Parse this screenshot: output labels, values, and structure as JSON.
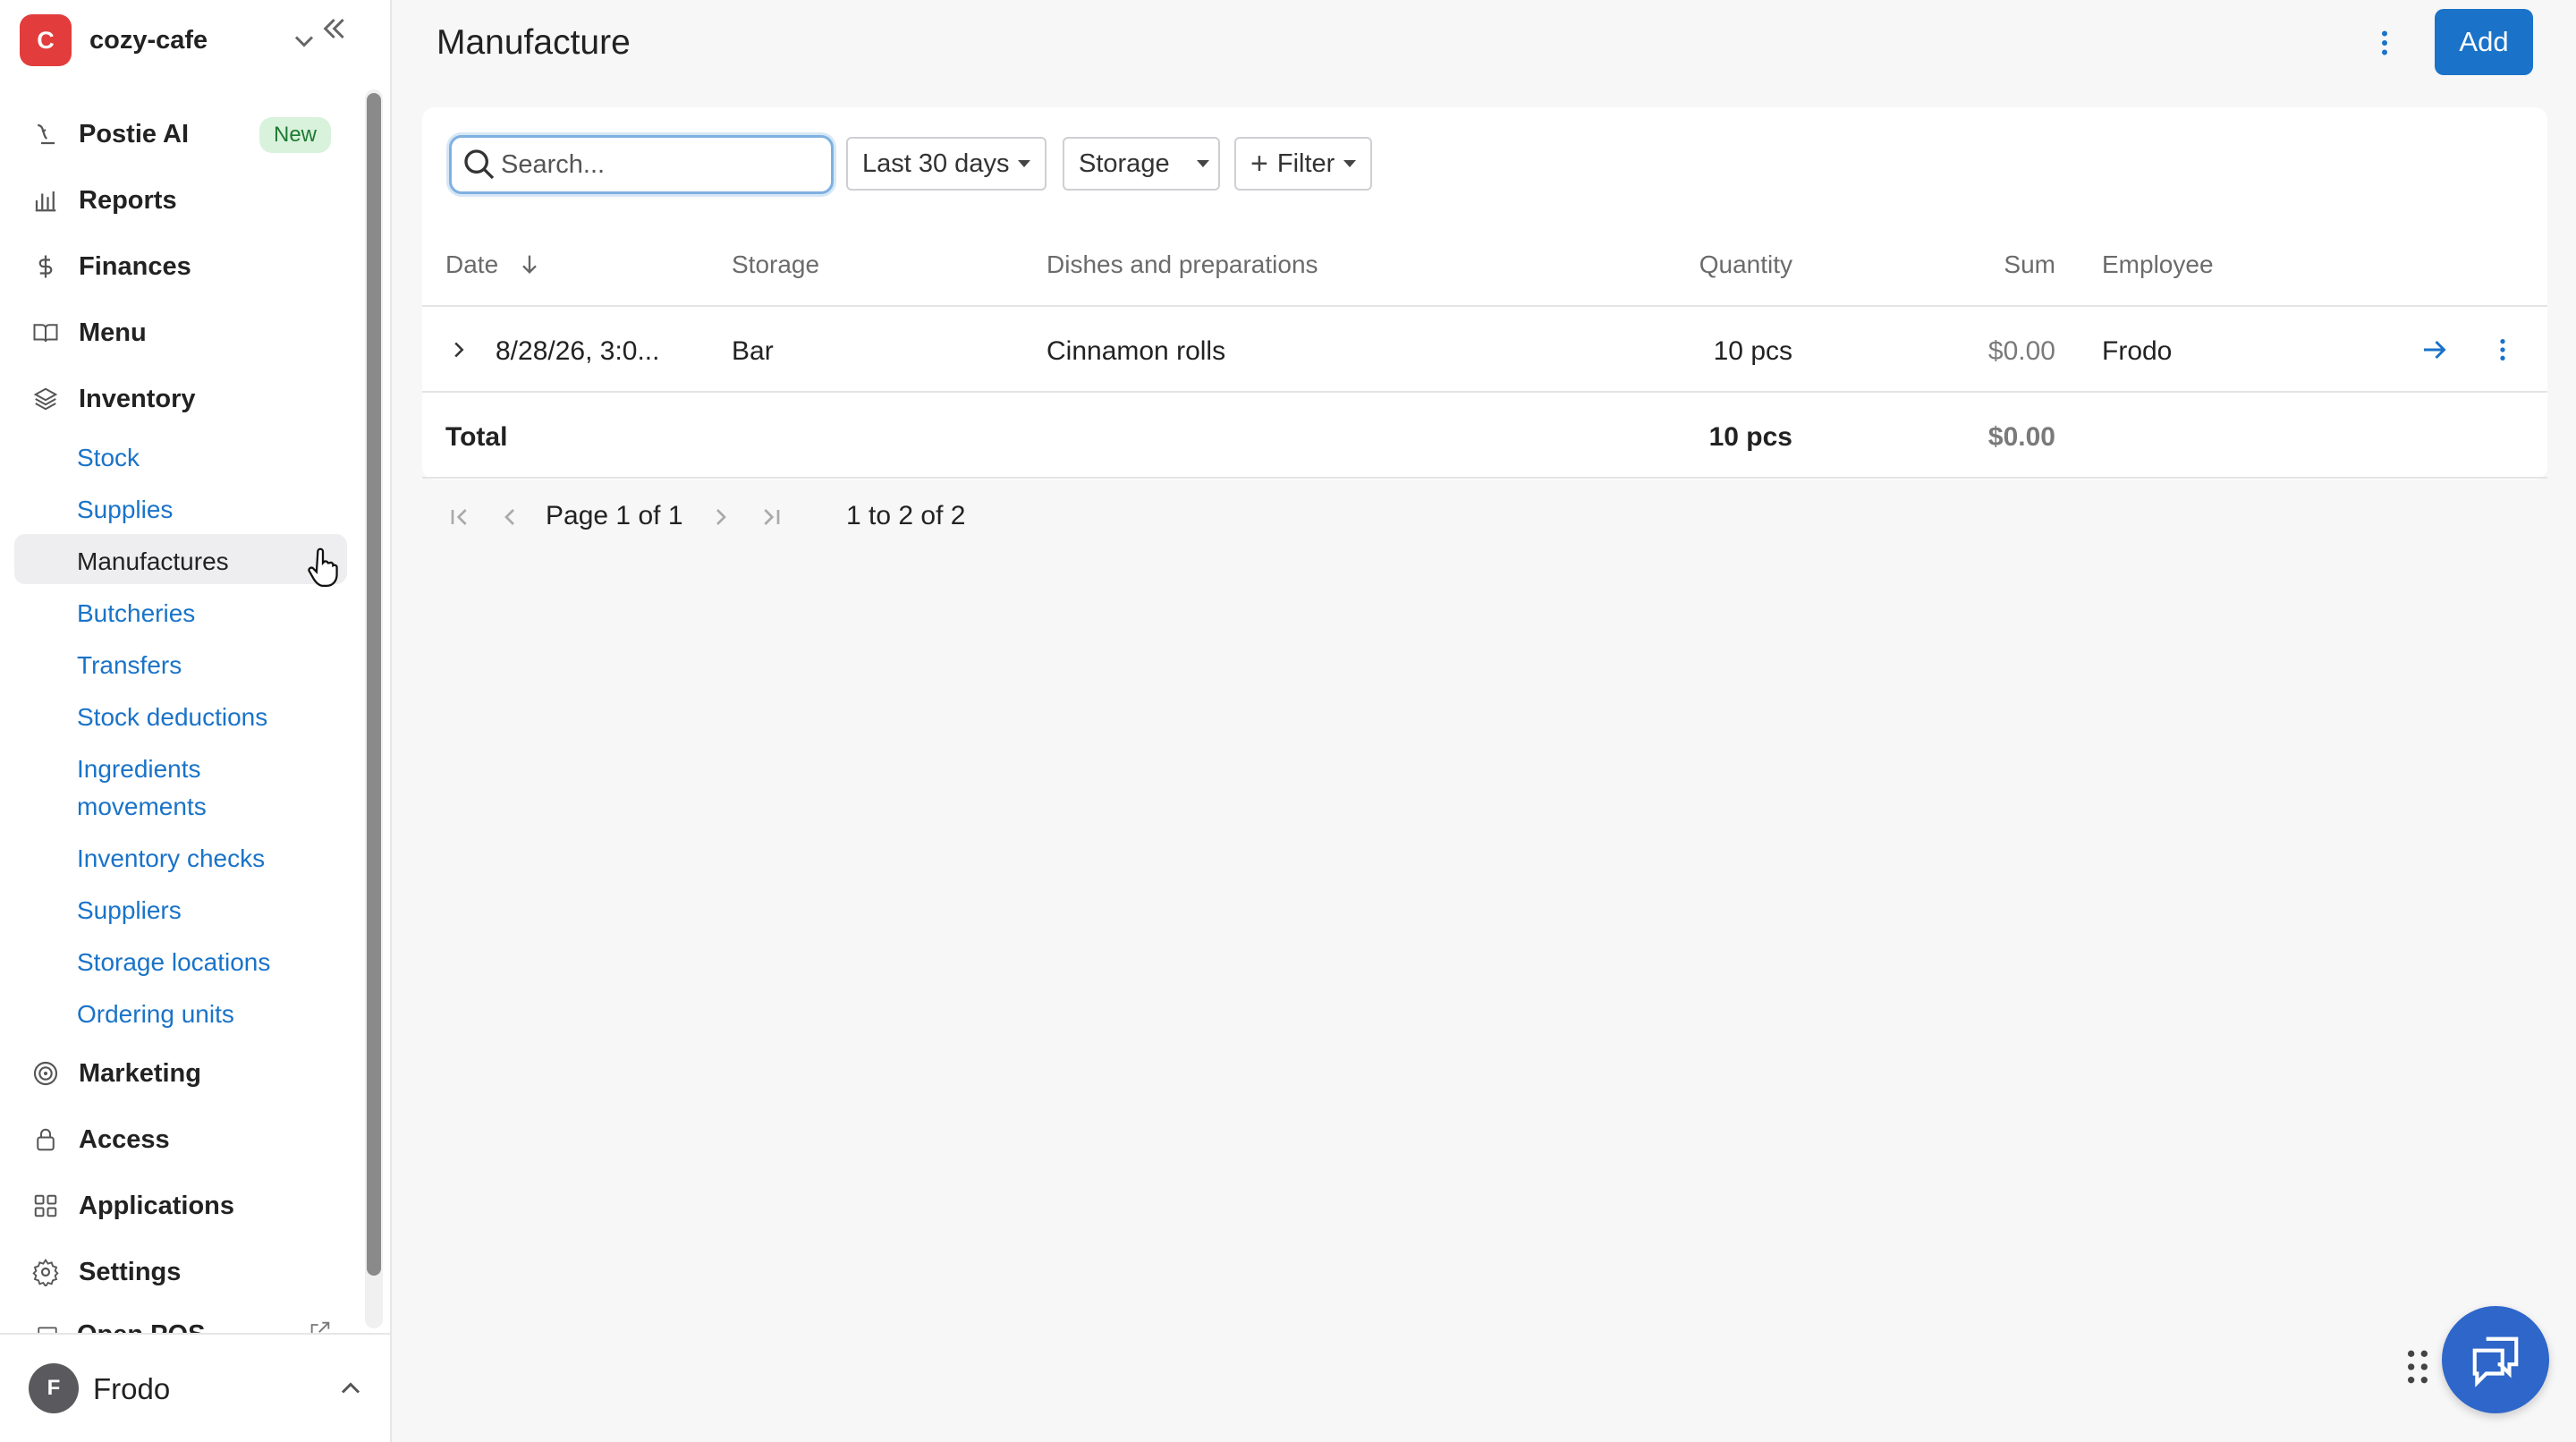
{
  "workspace": {
    "initial": "C",
    "name": "cozy-cafe"
  },
  "sidebar": {
    "items": [
      {
        "label": "Postie AI",
        "badge": "New",
        "icon": "postie-ai-icon"
      },
      {
        "label": "Reports",
        "icon": "bar-chart-icon"
      },
      {
        "label": "Finances",
        "icon": "dollar-icon"
      },
      {
        "label": "Menu",
        "icon": "book-icon"
      },
      {
        "label": "Inventory",
        "icon": "layers-icon"
      }
    ],
    "inventory_sub": [
      "Stock",
      "Supplies",
      "Manufactures",
      "Butcheries",
      "Transfers",
      "Stock deductions",
      "Ingredients",
      "movements",
      "Inventory checks",
      "Suppliers",
      "Storage locations",
      "Ordering units"
    ],
    "items_bottom": [
      {
        "label": "Marketing",
        "icon": "target-icon"
      },
      {
        "label": "Access",
        "icon": "lock-icon"
      },
      {
        "label": "Applications",
        "icon": "grid-icon"
      },
      {
        "label": "Settings",
        "icon": "gear-icon"
      }
    ],
    "cut_item": "Open POS"
  },
  "user": {
    "initial": "F",
    "name": "Frodo"
  },
  "header": {
    "title": "Manufacture",
    "add_label": "Add"
  },
  "toolbar": {
    "search_placeholder": "Search...",
    "period": "Last 30 days",
    "storage": "Storage",
    "filter": "Filter"
  },
  "table": {
    "columns": [
      "Date",
      "Storage",
      "Dishes and preparations",
      "Quantity",
      "Sum",
      "Employee"
    ],
    "rows": [
      {
        "date": "8/28/26, 3:0...",
        "storage": "Bar",
        "dishes": "Cinnamon rolls",
        "quantity": "10 pcs",
        "sum": "$0.00",
        "employee": "Frodo"
      }
    ],
    "total": {
      "label": "Total",
      "quantity": "10 pcs",
      "sum": "$0.00"
    }
  },
  "pagination": {
    "page_text": "Page",
    "page": "1",
    "of_text": "of",
    "pages": "1",
    "range": "1 to 2 of 2"
  },
  "colors": {
    "accent": "#1a73c8",
    "brand": "#e23c3c",
    "chat": "#2f66c9"
  }
}
